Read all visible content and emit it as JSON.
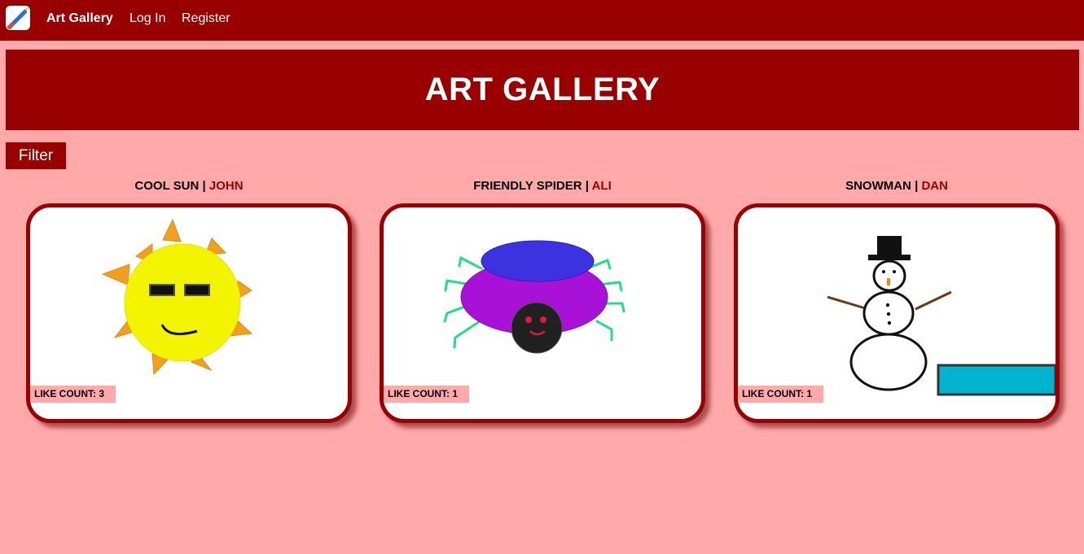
{
  "navbar": {
    "brand_label": "Art Gallery",
    "logo_icon": "paintbrush-icon",
    "links": [
      {
        "label": "Log In"
      },
      {
        "label": "Register"
      }
    ]
  },
  "hero": {
    "title": "ART GALLERY"
  },
  "filter": {
    "label": "Filter"
  },
  "separator": "|",
  "artworks": [
    {
      "title": "COOL SUN",
      "artist": "JOHN",
      "like_label": "LIKE COUNT:",
      "likes": 3,
      "drawing": "sun-with-sunglasses"
    },
    {
      "title": "FRIENDLY SPIDER",
      "artist": "ALI",
      "like_label": "LIKE COUNT:",
      "likes": 1,
      "drawing": "purple-spider"
    },
    {
      "title": "SNOWMAN",
      "artist": "DAN",
      "like_label": "LIKE COUNT:",
      "likes": 1,
      "drawing": "snowman-with-hat"
    }
  ],
  "colors": {
    "primary": "#990000",
    "background": "#ffa9ab",
    "card": "#ffffff"
  }
}
